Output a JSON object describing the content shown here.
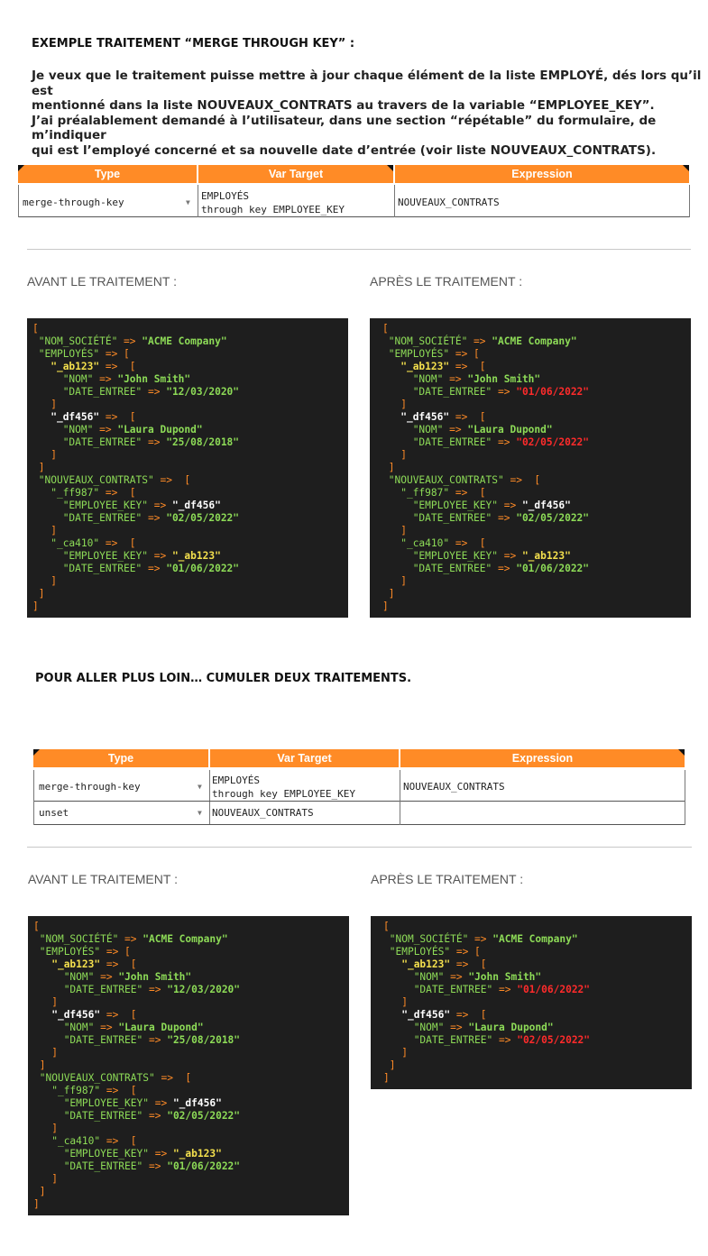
{
  "title": "EXEMPLE TRAITEMENT “MERGE THROUGH KEY” :",
  "intro": [
    "Je veux que le traitement puisse mettre à jour chaque élément de la liste EMPLOYÉ, dés lors qu’il est",
    "mentionné dans la liste NOUVEAUX_CONTRATS au travers de la variable “EMPLOYEE_KEY”.",
    "J’ai préalablement demandé à l’utilisateur, dans une section “répétable” du formulaire, de m’indiquer",
    "qui est l’employé concerné et sa nouvelle date d’entrée (voir liste NOUVEAUX_CONTRATS)."
  ],
  "table_headers": {
    "type": "Type",
    "var_target": "Var Target",
    "expression": "Expression"
  },
  "table1": {
    "rows": [
      {
        "type": "merge-through-key",
        "target_line1": "EMPLOYÉS",
        "target_line2": "through key EMPLOYEE_KEY",
        "expression": "NOUVEAUX_CONTRATS"
      }
    ]
  },
  "table2": {
    "rows": [
      {
        "type": "merge-through-key",
        "target_line1": "EMPLOYÉS",
        "target_line2": "through key EMPLOYEE_KEY",
        "expression": "NOUVEAUX_CONTRATS"
      },
      {
        "type": "unset",
        "target_line1": "NOUVEAUX_CONTRATS",
        "target_line2": "",
        "expression": ""
      }
    ]
  },
  "labels": {
    "before": "AVANT LE TRAITEMENT :",
    "after": "APRÈS LE TRAITEMENT :",
    "more": "POUR ALLER PLUS LOIN… CUMULER DEUX TRAITEMENTS."
  },
  "colors": {
    "accent": "#ff8b26",
    "code_bg": "#1e1e1e",
    "green": "#8ddb57",
    "red": "#ff2b2b",
    "yellow": "#f4e04d"
  },
  "code": {
    "company_key": "\"NOM_SOCIÉTÉ\"",
    "company_val": "\"ACME Company\"",
    "employes_key": "\"EMPLOYÉS\"",
    "contrats_key": "\"NOUVEAUX_CONTRATS\"",
    "nom_key": "\"NOM\"",
    "date_key": "\"DATE_ENTREE\"",
    "empkey_key": "\"EMPLOYEE_KEY\"",
    "ab123": "\"_ab123\"",
    "df456": "\"_df456\"",
    "ff987": "\"_ff987\"",
    "ca410": "\"_ca410\"",
    "john": "\"John Smith\"",
    "laura": "\"Laura Dupond\"",
    "date_ab_before": "\"12/03/2020\"",
    "date_df_before": "\"25/08/2018\"",
    "date_ab_after": "\"01/06/2022\"",
    "date_df_after": "\"02/05/2022\"",
    "date_ff": "\"02/05/2022\"",
    "date_ca": "\"01/06/2022\"",
    "ref_df": "\"_df456\"",
    "ref_ab": "\"_ab123\""
  }
}
